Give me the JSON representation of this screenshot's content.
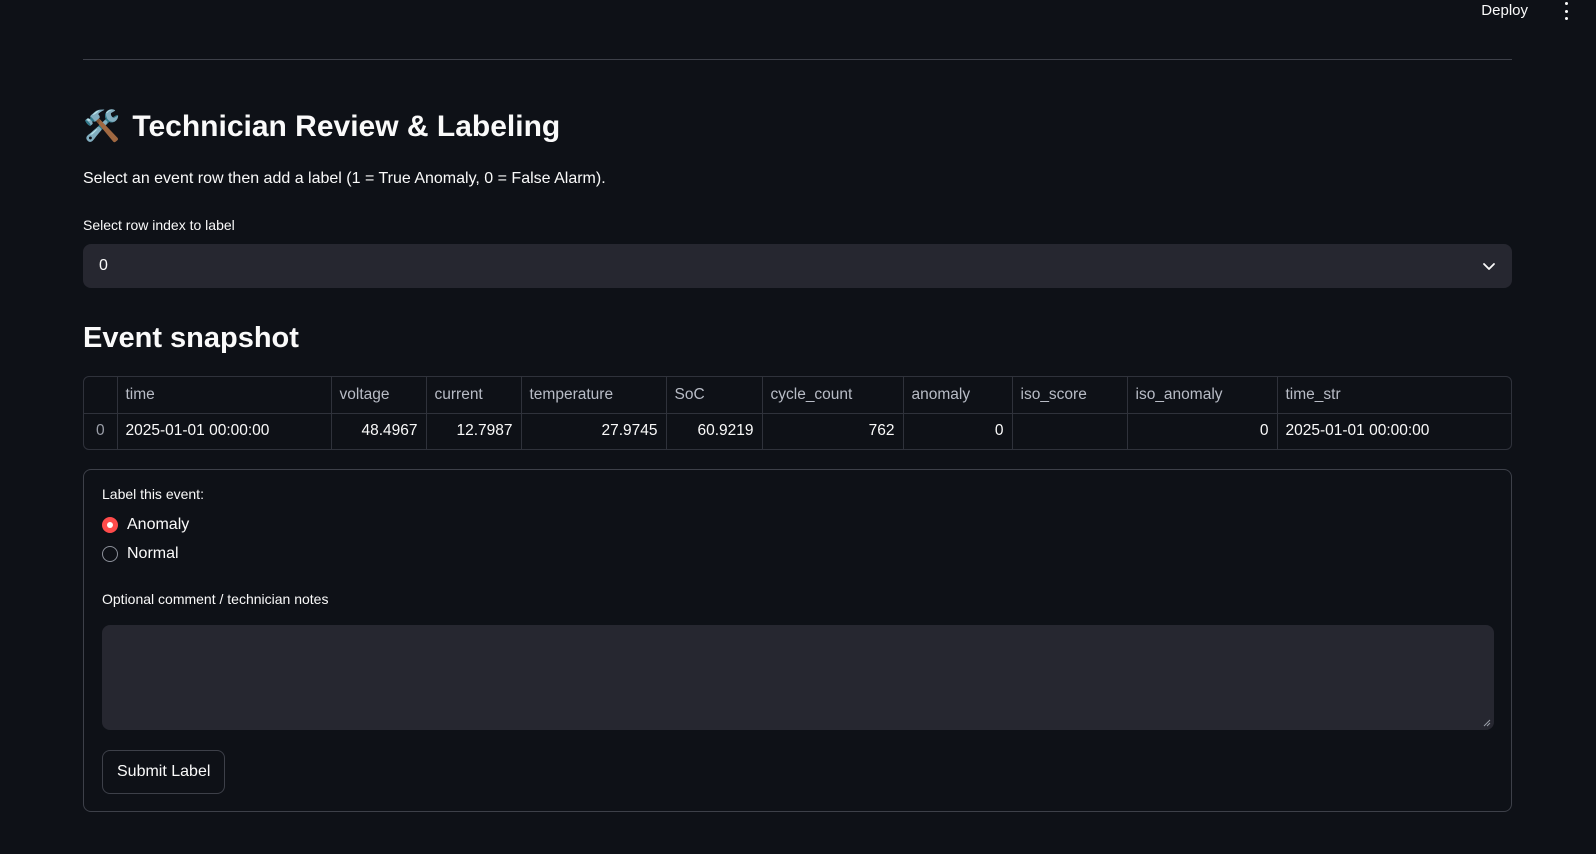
{
  "header": {
    "deploy_label": "Deploy",
    "menu_icon": "kebab-menu-icon"
  },
  "section": {
    "title_icon": "🛠️",
    "title": "Technician Review & Labeling",
    "description": "Select an event row then add a label (1 = True Anomaly, 0 = False Alarm)."
  },
  "row_select": {
    "label": "Select row index to label",
    "value": "0"
  },
  "snapshot": {
    "heading": "Event snapshot",
    "columns": [
      "",
      "time",
      "voltage",
      "current",
      "temperature",
      "SoC",
      "cycle_count",
      "anomaly",
      "iso_score",
      "iso_anomaly",
      "time_str"
    ],
    "row": {
      "index": "0",
      "time": "2025-01-01 00:00:00",
      "voltage": "48.4967",
      "current": "12.7987",
      "temperature": "27.9745",
      "soc": "60.9219",
      "cycle_count": "762",
      "anomaly": "0",
      "iso_score": "",
      "iso_anomaly": "0",
      "time_str": "2025-01-01 00:00:00"
    }
  },
  "form": {
    "label_prompt": "Label this event:",
    "options": [
      "Anomaly",
      "Normal"
    ],
    "selected": "Anomaly",
    "notes_label": "Optional comment / technician notes",
    "notes_value": "",
    "submit_label": "Submit Label"
  },
  "colors": {
    "background": "#0e1117",
    "input_bg": "#262730",
    "accent": "#ff4b4b",
    "border": "#3d4049"
  }
}
